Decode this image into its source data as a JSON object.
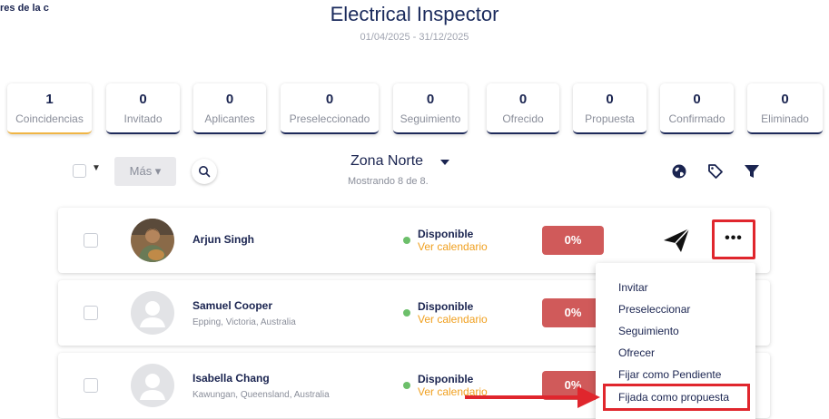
{
  "header": {
    "corner_text": "res de la c",
    "title": "Electrical Inspector",
    "date_range": "01/04/2025 - 31/12/2025"
  },
  "stages": [
    {
      "count": "1",
      "label": "Coincidencias"
    },
    {
      "count": "0",
      "label": "Invitado"
    },
    {
      "count": "0",
      "label": "Aplicantes"
    },
    {
      "count": "0",
      "label": "Preseleccionado"
    },
    {
      "count": "0",
      "label": "Seguimiento"
    },
    {
      "count": "0",
      "label": "Ofrecido"
    },
    {
      "count": "0",
      "label": "Propuesta"
    },
    {
      "count": "0",
      "label": "Confirmado"
    },
    {
      "count": "0",
      "label": "Eliminado"
    }
  ],
  "toolbar": {
    "more_label": "Más ▾",
    "zone": "Zona Norte",
    "showing": "Mostrando 8 de 8."
  },
  "candidates": [
    {
      "name": "Arjun Singh",
      "location": "",
      "status": "Disponible",
      "calendar": "Ver calendario",
      "match": "0%"
    },
    {
      "name": "Samuel Cooper",
      "location": "Epping, Victoria, Australia",
      "status": "Disponible",
      "calendar": "Ver calendario",
      "match": "0%"
    },
    {
      "name": "Isabella Chang",
      "location": "Kawungan, Queensland, Australia",
      "status": "Disponible",
      "calendar": "Ver calendario",
      "match": "0%"
    }
  ],
  "menu": {
    "items": [
      "Invitar",
      "Preseleccionar",
      "Seguimiento",
      "Ofrecer",
      "Fijar como Pendiente",
      "Fijada como propuesta"
    ]
  },
  "colors": {
    "accent_active": "#f0b545",
    "navy": "#1a2450",
    "match_badge": "#d05a5a",
    "highlight": "#e0262d",
    "available_dot": "#6cbf6a",
    "calendar_link": "#f0a020"
  }
}
